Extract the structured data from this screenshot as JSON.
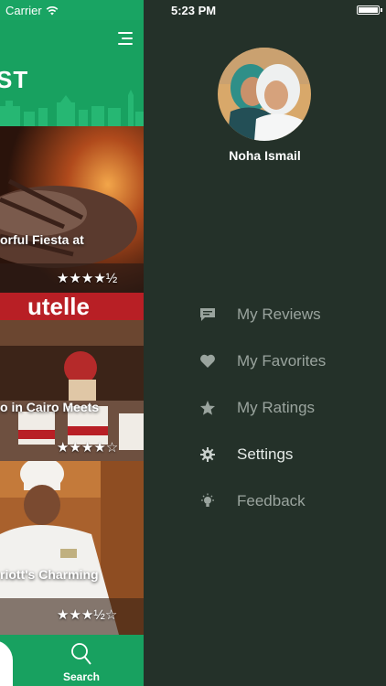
{
  "status_bar": {
    "carrier": "Carrier",
    "time": "5:23 PM"
  },
  "header": {
    "title_fragment": "ST"
  },
  "feed": {
    "items": [
      {
        "caption": "orful Fiesta at",
        "rating": 4.5,
        "stars_text": "★★★★½"
      },
      {
        "caption": "o in Cairo Meets",
        "rating": 4,
        "stars_text": "★★★★☆"
      },
      {
        "caption": "riott's Charming",
        "rating": 3.5,
        "stars_text": "★★★½☆"
      }
    ]
  },
  "tab_bar": {
    "search_label": "Search"
  },
  "drawer": {
    "user_name": "Noha Ismail",
    "menu": [
      {
        "label": "My Reviews",
        "icon": "chat-bubble-icon"
      },
      {
        "label": "My Favorites",
        "icon": "heart-icon"
      },
      {
        "label": "My Ratings",
        "icon": "star-icon"
      },
      {
        "label": "Settings",
        "icon": "gear-icon"
      },
      {
        "label": "Feedback",
        "icon": "lightbulb-icon"
      }
    ],
    "active_item": "Settings"
  },
  "colors": {
    "brand_green": "#18a160",
    "drawer_bg": "#243129",
    "menu_text": "#9aa49e"
  }
}
